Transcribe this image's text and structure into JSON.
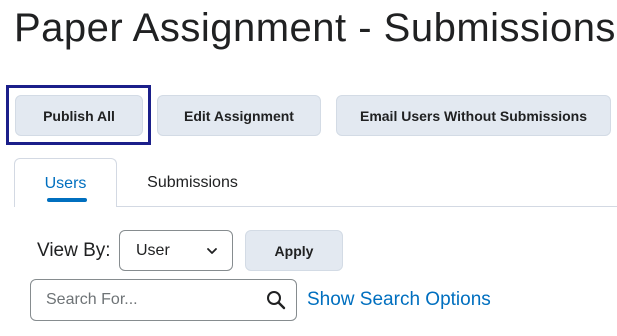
{
  "page": {
    "title": "Paper Assignment - Submissions"
  },
  "toolbar": {
    "publish_all_label": "Publish All",
    "edit_assignment_label": "Edit Assignment",
    "email_users_label": "Email Users Without Submissions",
    "focused_button": "Publish All"
  },
  "tabs": [
    {
      "label": "Users",
      "active": true
    },
    {
      "label": "Submissions",
      "active": false
    }
  ],
  "filters": {
    "view_by_label": "View By:",
    "view_by_value": "User",
    "apply_label": "Apply"
  },
  "search": {
    "placeholder": "Search For...",
    "value": "",
    "show_options_label": "Show Search Options"
  },
  "colors": {
    "accent": "#006fbf",
    "button_bg": "#e3e9f1",
    "focus_ring": "#1b1f8a",
    "border": "#868c8f"
  },
  "icons": {
    "select_chevron": "chevron-down-icon",
    "search": "search-icon"
  }
}
